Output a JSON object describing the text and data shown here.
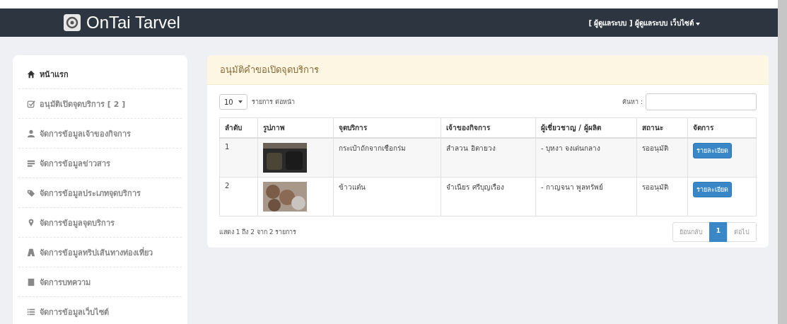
{
  "navbar": {
    "brand": "OnTai Tarvel",
    "user_menu": "[ ผู้ดูแลระบบ ] ผู้ดูแลระบบ เว็บไซต์"
  },
  "sidebar": {
    "items": [
      {
        "label": "หน้าแรก",
        "selected": true
      },
      {
        "label": "อนุมัติเปิดจุดบริการ [ 2 ]",
        "selected": false
      },
      {
        "label": "จัดการข้อมูลเจ้าของกิจการ",
        "selected": false
      },
      {
        "label": "จัดการข้อมูลข่าวสาร",
        "selected": false
      },
      {
        "label": "จัดการข้อมูลประเภทจุดบริการ",
        "selected": false
      },
      {
        "label": "จัดการข้อมูลจุดบริการ",
        "selected": false
      },
      {
        "label": "จัดการข้อมูลทริปเส้นทางท่องเที่ยว",
        "selected": false
      },
      {
        "label": "จัดการบทความ",
        "selected": false
      },
      {
        "label": "จัดการข้อมูลเว็บไซต์",
        "selected": false
      }
    ]
  },
  "panel": {
    "title": "อนุมัติคำขอเปิดจุดบริการ",
    "page_size": "10",
    "page_size_label": "รายการ ต่อหน้า",
    "search_label": "ค้นหา :",
    "table": {
      "columns": [
        "ลำดับ",
        "รูปภาพ",
        "จุดบริการ",
        "เจ้าของกิจการ",
        "ผู้เชี่ยวชาญ / ผู้ผลิต",
        "สถานะ",
        "จัดการ"
      ],
      "rows": [
        {
          "no": "1",
          "service_point": "กระเป๋าถักจากเชือกร่ม",
          "owner": "สำลวน อิตายวง",
          "expert": "- บุหงา จงเด่นกลาง",
          "status": "รออนุมัติ",
          "action": "รายละเอียด"
        },
        {
          "no": "2",
          "service_point": "ข้าวแต๋น",
          "owner": "จำเนียร ศรีบุญเรือง",
          "expert": "- กาญจนา พูลทรัพย์",
          "status": "รออนุมัติ",
          "action": "รายละเอียด"
        }
      ]
    },
    "info": "แสดง 1 ถึง 2 จาก 2 รายการ",
    "pagination": [
      {
        "label": "ย้อนกลับ",
        "selected": false
      },
      {
        "label": "1",
        "selected": true
      },
      {
        "label": "ต่อไป",
        "selected": false
      }
    ]
  }
}
